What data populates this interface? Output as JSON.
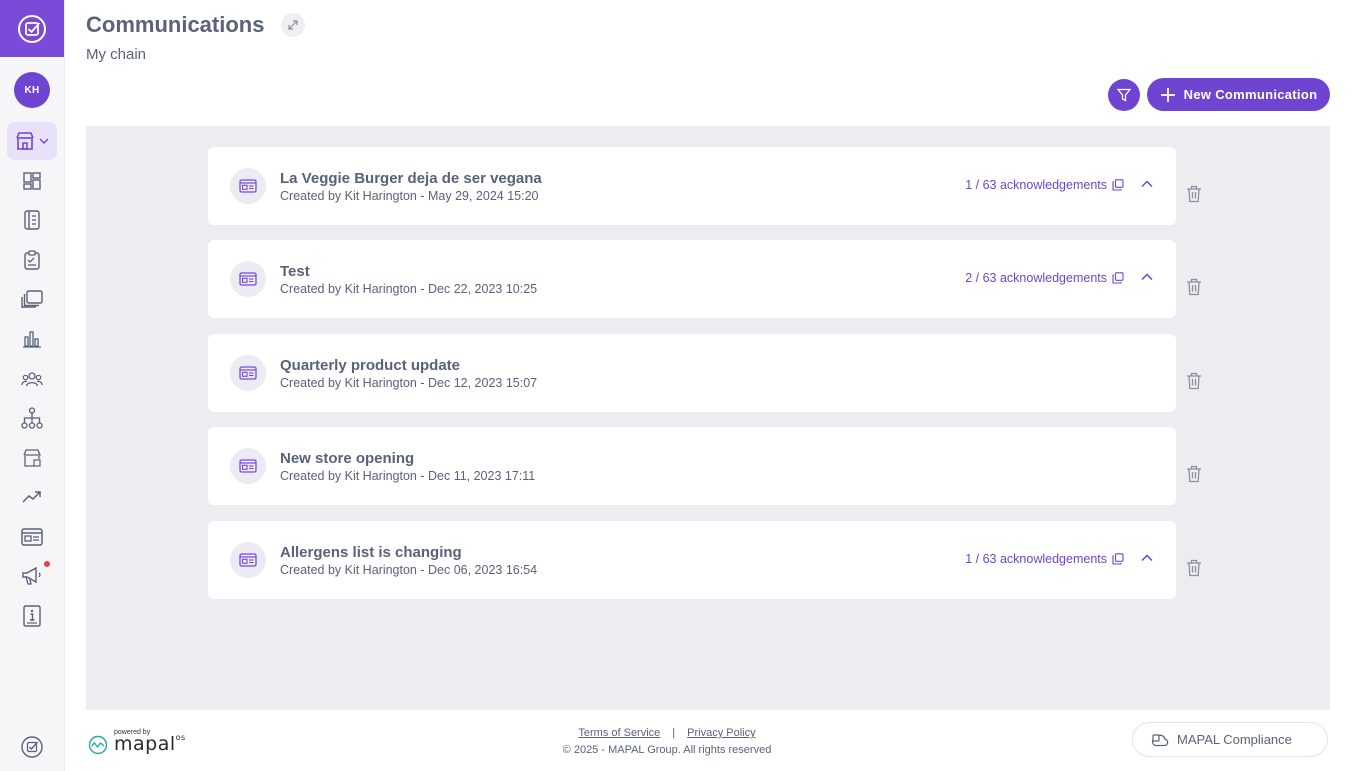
{
  "sidebar": {
    "avatar_initials": "KH",
    "notification_dot_color": "#e8413b",
    "icons": [
      "dashboard-icon",
      "logbook-icon",
      "checklist-icon",
      "library-icon",
      "reports-icon",
      "users-icon",
      "hierarchy-icon",
      "stores-icon",
      "trends-icon",
      "communications-icon",
      "announcements-icon",
      "info-icon"
    ]
  },
  "header": {
    "title": "Communications",
    "subtitle": "My chain",
    "new_button_label": "New Communication"
  },
  "colors": {
    "accent": "#6e44d0",
    "panel_bg": "#ededf1",
    "text": "#5a6278"
  },
  "communications": [
    {
      "title": "La Veggie Burger deja de ser vegana",
      "meta": "Created by Kit Harington - May 29, 2024 15:20",
      "acknowledgements": "1 / 63 acknowledgements"
    },
    {
      "title": "Test",
      "meta": "Created by Kit Harington - Dec 22, 2023 10:25",
      "acknowledgements": "2 / 63 acknowledgements"
    },
    {
      "title": "Quarterly product update",
      "meta": "Created by Kit Harington - Dec 12, 2023 15:07",
      "acknowledgements": ""
    },
    {
      "title": "New store opening",
      "meta": "Created by Kit Harington - Dec 11, 2023 17:11",
      "acknowledgements": ""
    },
    {
      "title": "Allergens list is changing",
      "meta": "Created by Kit Harington - Dec 06, 2023 16:54",
      "acknowledgements": "1 / 63 acknowledgements"
    }
  ],
  "footer": {
    "powered_by": "powered by",
    "brand": "mapal",
    "brand_suffix": "os",
    "terms": "Terms of Service",
    "separator": "|",
    "privacy": "Privacy Policy",
    "copyright": "© 2025 - MAPAL Group. All rights reserved",
    "compliance_label": "MAPAL Compliance"
  }
}
